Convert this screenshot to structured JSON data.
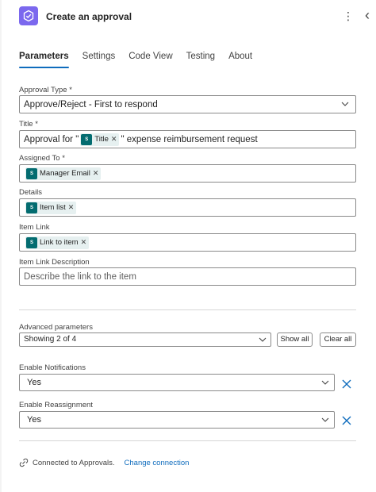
{
  "header": {
    "title": "Create an approval",
    "app_icon": "approvals-icon",
    "more_icon": "more-vertical-icon",
    "collapse_icon": "chevron-left-icon",
    "accent_color": "#7b68ee"
  },
  "tabs": [
    {
      "label": "Parameters",
      "active": true
    },
    {
      "label": "Settings",
      "active": false
    },
    {
      "label": "Code View",
      "active": false
    },
    {
      "label": "Testing",
      "active": false
    },
    {
      "label": "About",
      "active": false
    }
  ],
  "fields": {
    "approval_type": {
      "label": "Approval Type *",
      "value": "Approve/Reject - First to respond"
    },
    "title": {
      "label": "Title *",
      "prefix": "Approval for \"",
      "token": "Title",
      "suffix": "\" expense reimbursement request"
    },
    "assigned_to": {
      "label": "Assigned To *",
      "token": "Manager Email"
    },
    "details": {
      "label": "Details",
      "token": "Item list"
    },
    "item_link": {
      "label": "Item Link",
      "token": "Link to item"
    },
    "item_link_description": {
      "label": "Item Link Description",
      "placeholder": "Describe the link to the item"
    }
  },
  "advanced": {
    "label": "Advanced parameters",
    "value": "Showing 2 of 4",
    "show_all": "Show all",
    "clear_all": "Clear all"
  },
  "notifications": {
    "label": "Enable Notifications",
    "value": "Yes"
  },
  "reassignment": {
    "label": "Enable Reassignment",
    "value": "Yes"
  },
  "footer": {
    "connected_text": "Connected to Approvals.",
    "change_link": "Change connection"
  },
  "token_color": "#036c70",
  "link_color": "#0f6cbd"
}
